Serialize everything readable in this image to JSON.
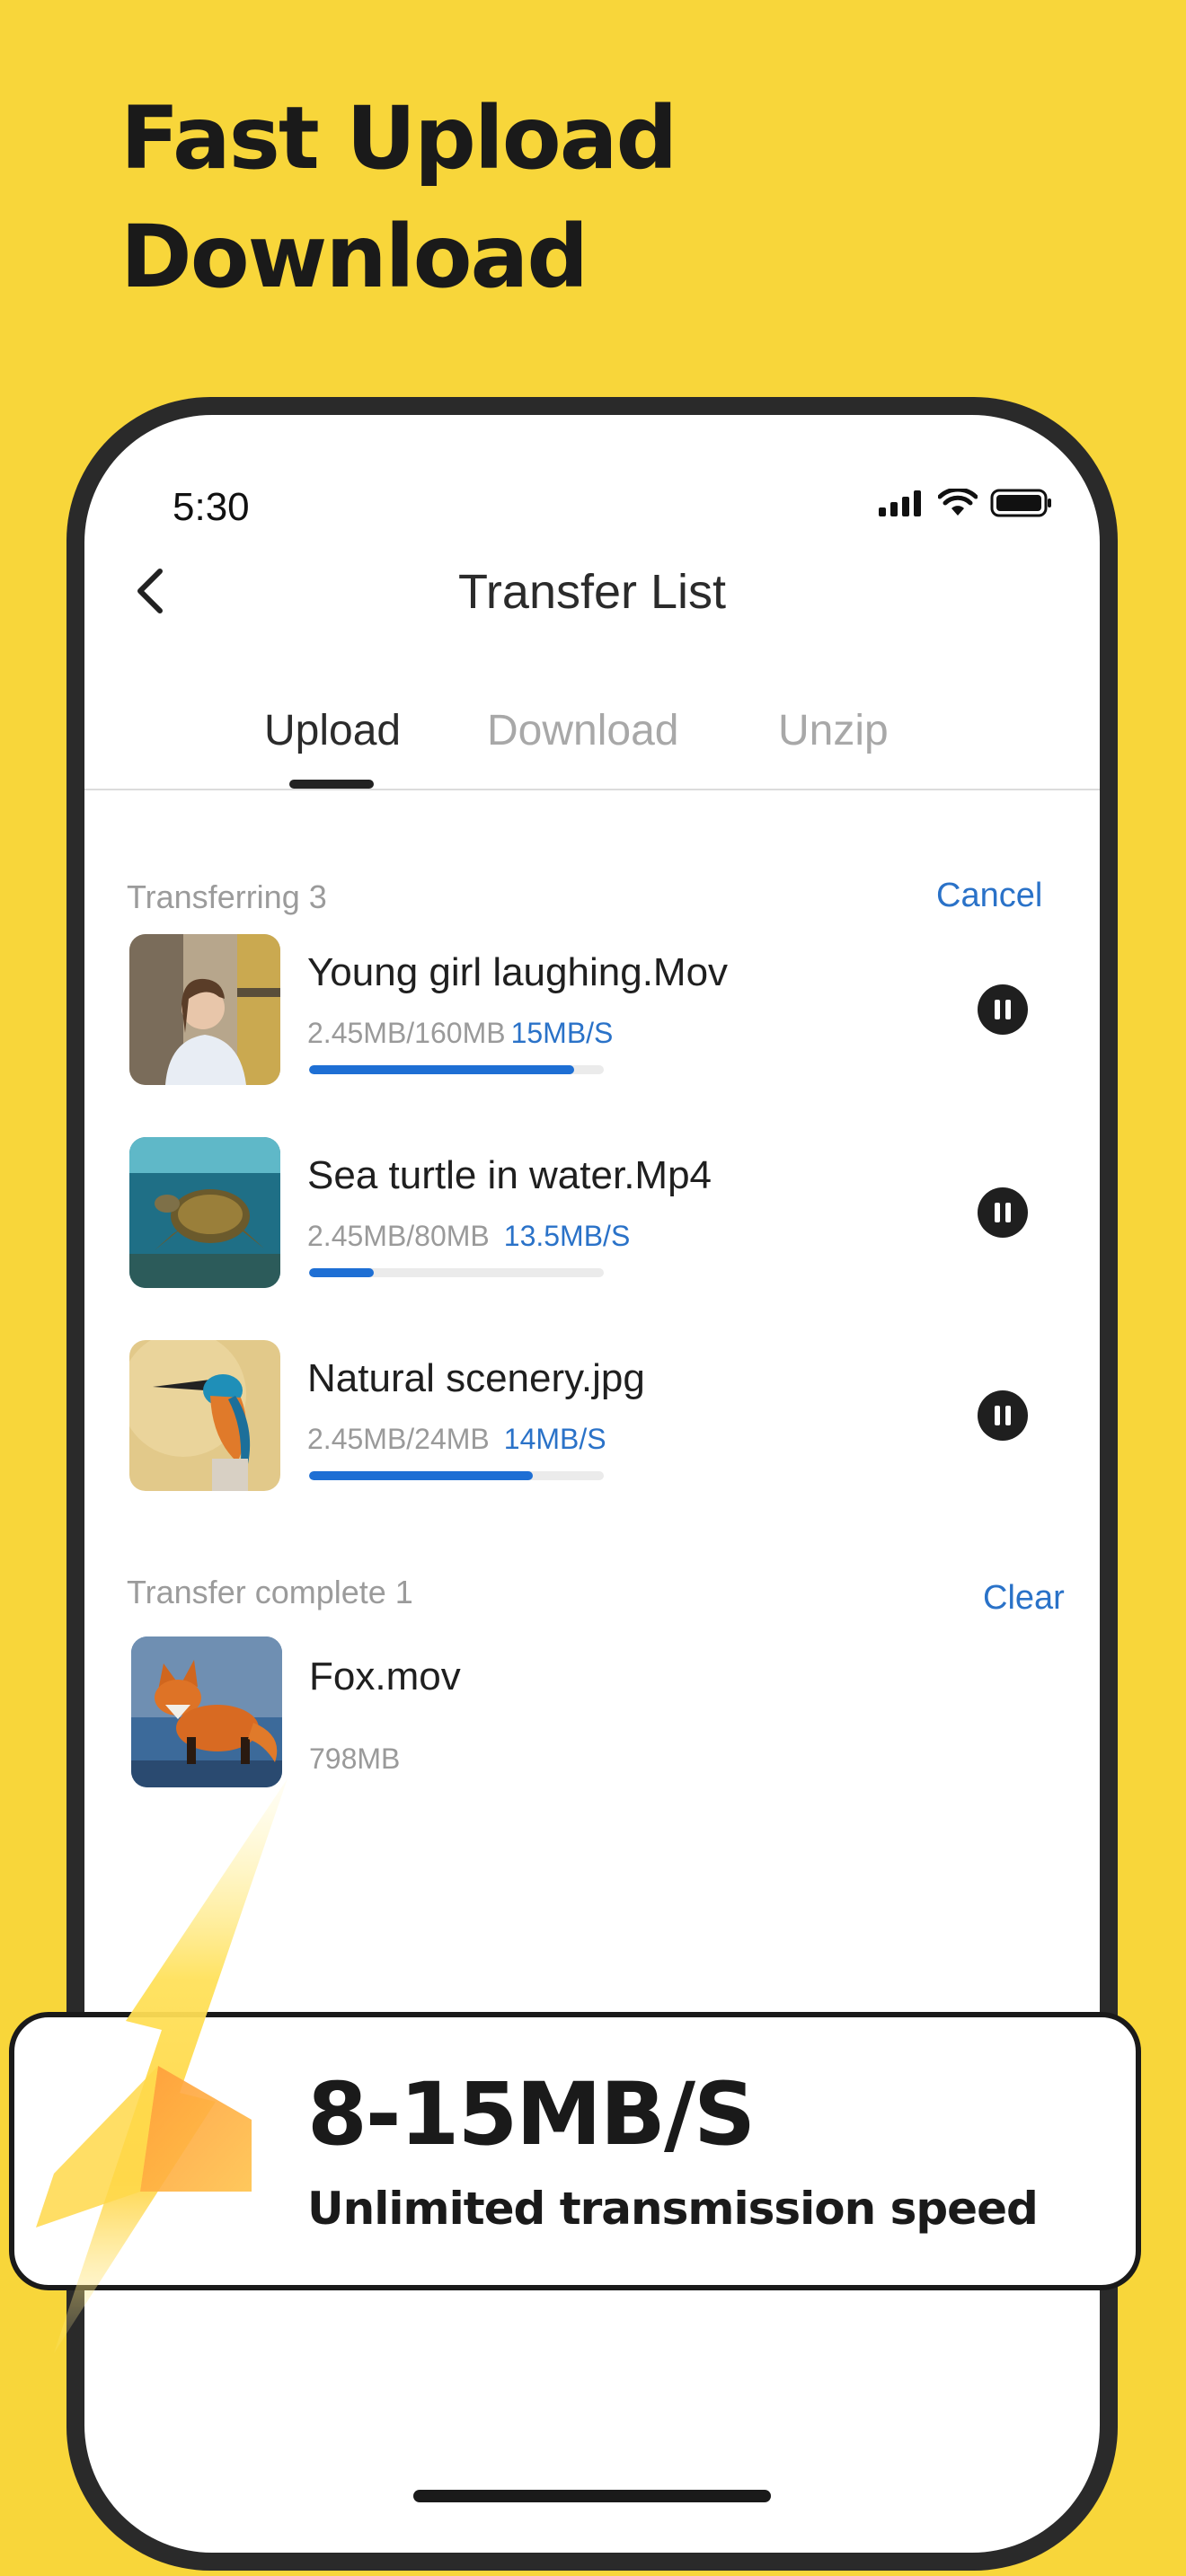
{
  "headline": {
    "line1": "Fast Upload",
    "line2": "Download"
  },
  "status_bar": {
    "time": "5:30"
  },
  "nav": {
    "title": "Transfer List"
  },
  "tabs": [
    {
      "label": "Upload",
      "active": true
    },
    {
      "label": "Download",
      "active": false
    },
    {
      "label": "Unzip",
      "active": false
    }
  ],
  "transferring": {
    "label": "Transferring 3",
    "action": "Cancel",
    "items": [
      {
        "name": "Young girl laughing.Mov",
        "size": "2.45MB/160MB",
        "speed": "15MB/S",
        "progress": 0.9
      },
      {
        "name": "Sea turtle in water.Mp4",
        "size": "2.45MB/80MB",
        "speed": "13.5MB/S",
        "progress": 0.22
      },
      {
        "name": "Natural scenery.jpg",
        "size": "2.45MB/24MB",
        "speed": "14MB/S",
        "progress": 0.76
      }
    ]
  },
  "complete": {
    "label": "Transfer complete 1",
    "action": "Clear",
    "items": [
      {
        "name": "Fox.mov",
        "size": "798MB"
      }
    ]
  },
  "banner": {
    "speed": "8-15MB/S",
    "subtitle": "Unlimited transmission speed"
  },
  "colors": {
    "background": "#F8D63A",
    "accent": "#2a72c8",
    "progress": "#1e6fd4"
  }
}
